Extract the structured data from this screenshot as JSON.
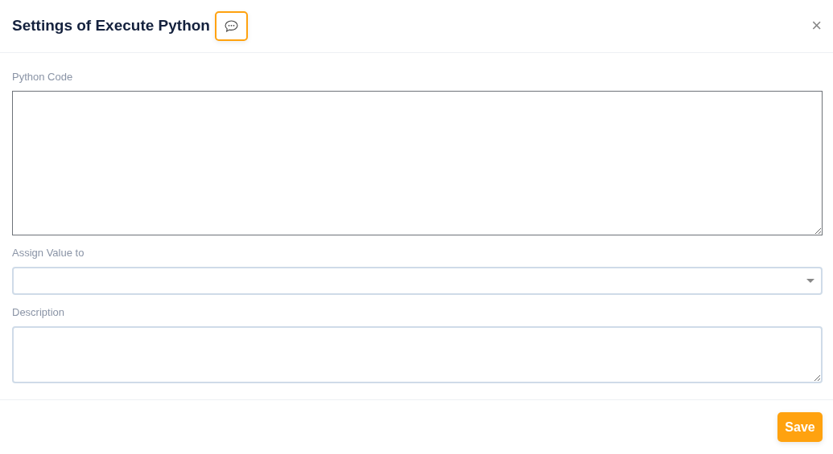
{
  "dialog": {
    "title": "Settings of Execute Python",
    "close": "×"
  },
  "fields": [
    {
      "kind": "code",
      "label": "Python Code",
      "focused": true
    },
    {
      "kind": "select",
      "label": "Assign Value to",
      "focused": false
    },
    {
      "kind": "text",
      "label": "Description",
      "focused": false
    }
  ],
  "buttons": [
    {
      "label": "Save"
    }
  ]
}
